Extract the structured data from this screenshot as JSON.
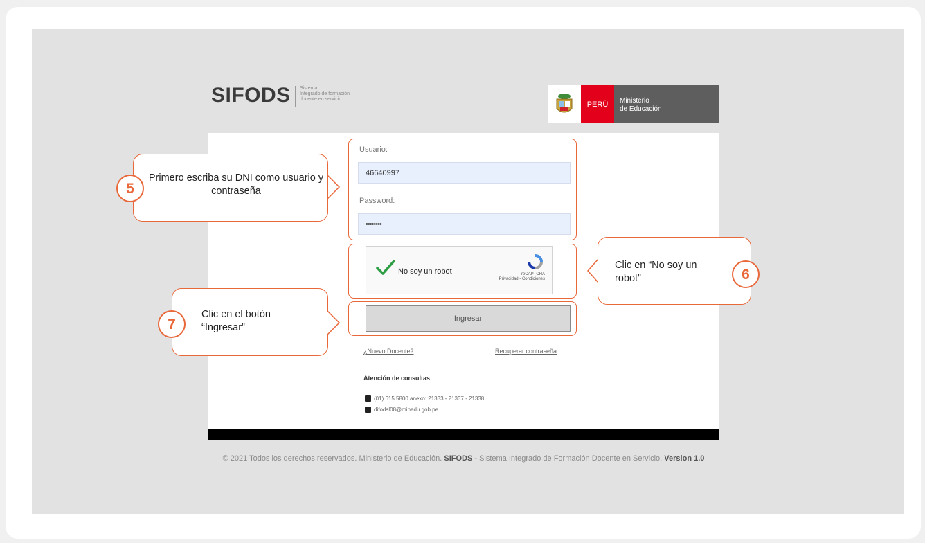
{
  "header": {
    "logo_title": "SIFODS",
    "logo_subtitle": "Sistema\nIntegrado de formación\ndocente en servicio",
    "peru_label": "PERÚ",
    "ministry": "Ministerio\nde Educación"
  },
  "login": {
    "user_label": "Usuario:",
    "user_value": "46640997",
    "password_label": "Password:",
    "password_value": "••••••••",
    "captcha_text": "No soy un robot",
    "captcha_brand": "reCAPTCHA",
    "captcha_links": "Privacidad - Condiciones",
    "submit_label": "Ingresar",
    "new_teacher_link": "¿Nuevo Docente?",
    "recover_link": "Recuperar contraseña"
  },
  "contact": {
    "title": "Atención de consultas",
    "phone": "(01) 615 5800 anexo: 21333 - 21337 - 21338",
    "email": "difodsl08@minedu.gob.pe"
  },
  "footer": {
    "copyright": "© 2021 Todos los derechos reservados. Ministerio de Educación.",
    "system_name": "SIFODS",
    "system_desc": " - Sistema Integrado de Formación Docente en Servicio.",
    "version": "Version 1.0"
  },
  "annotations": {
    "step5": {
      "number": "5",
      "text": "Primero escriba su DNI como usuario y contraseña"
    },
    "step6": {
      "number": "6",
      "text": "Clic en “No soy un robot”"
    },
    "step7": {
      "number": "7",
      "text": "Clic en el botón “Ingresar”"
    },
    "accent_color": "#e8683a"
  }
}
